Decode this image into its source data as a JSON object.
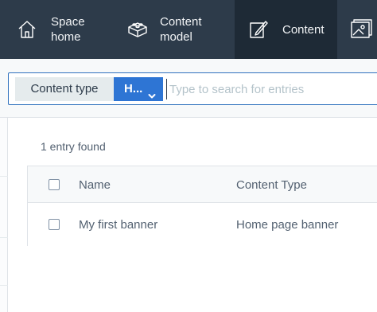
{
  "nav": {
    "items": [
      {
        "label": "Space home",
        "icon": "home-icon"
      },
      {
        "label": "Content model",
        "icon": "content-model-icon"
      },
      {
        "label": "Content",
        "icon": "content-icon",
        "active": true
      },
      {
        "label": "",
        "icon": "media-icon"
      }
    ]
  },
  "search": {
    "filter_label": "Content type",
    "filter_value": "H...",
    "placeholder": "Type to search for entries",
    "value": ""
  },
  "results": {
    "count_text": "1 entry found",
    "columns": [
      "Name",
      "Content Type"
    ],
    "rows": [
      {
        "name": "My first banner",
        "content_type": "Home page banner"
      }
    ]
  },
  "colors": {
    "nav_bg": "#2d3b4a",
    "nav_active_bg": "#1e2a36",
    "accent": "#2e75d4",
    "text": "#536171"
  }
}
